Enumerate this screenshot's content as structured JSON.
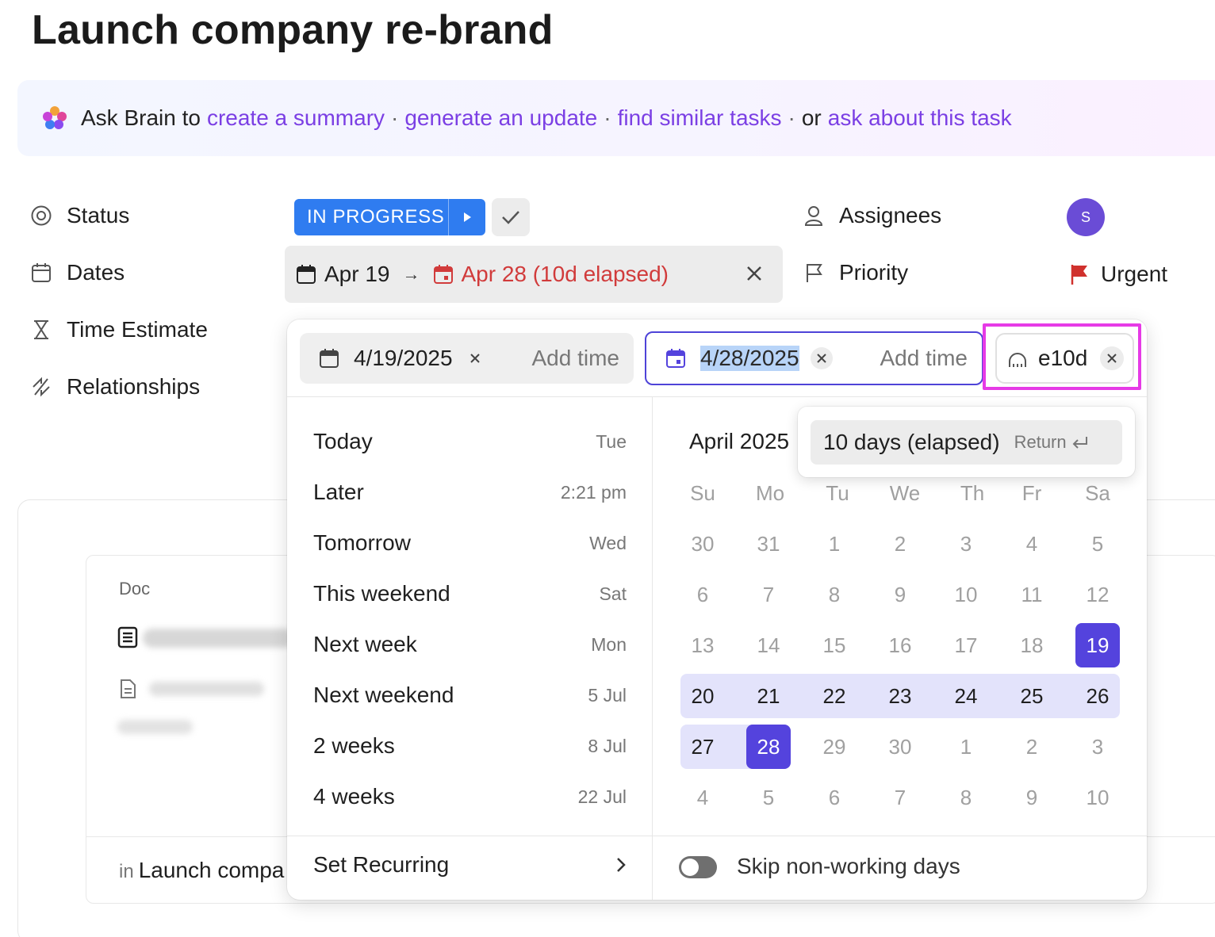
{
  "task": {
    "title": "Launch company re-brand"
  },
  "brain": {
    "prefix": "Ask Brain to",
    "link1": "create a summary",
    "link2": "generate an update",
    "link3": "find similar tasks",
    "or": "or",
    "link4": "ask about this task",
    "sep": "·"
  },
  "properties": {
    "status_label": "Status",
    "status_value": "IN PROGRESS",
    "dates_label": "Dates",
    "time_estimate_label": "Time Estimate",
    "relationships_label": "Relationships",
    "assignees_label": "Assignees",
    "assignee_initial": "S",
    "priority_label": "Priority",
    "priority_value": "Urgent"
  },
  "dates_bar": {
    "start": "Apr 19",
    "arrow": "→",
    "due": "Apr 28 (10d elapsed)"
  },
  "picker": {
    "start_date": "4/19/2025",
    "due_date": "4/28/2025",
    "add_time": "Add time",
    "duration_input": "e10d",
    "suggestion": "10 days (elapsed)",
    "suggestion_hint": "Return",
    "month_title": "April 2025",
    "weekdays": [
      "Su",
      "Mo",
      "Tu",
      "We",
      "Th",
      "Fr",
      "Sa"
    ],
    "weeks": [
      [
        "30",
        "31",
        "1",
        "2",
        "3",
        "4",
        "5"
      ],
      [
        "6",
        "7",
        "8",
        "9",
        "10",
        "11",
        "12"
      ],
      [
        "13",
        "14",
        "15",
        "16",
        "17",
        "18",
        "19"
      ],
      [
        "20",
        "21",
        "22",
        "23",
        "24",
        "25",
        "26"
      ],
      [
        "27",
        "28",
        "29",
        "30",
        "1",
        "2",
        "3"
      ],
      [
        "4",
        "5",
        "6",
        "7",
        "8",
        "9",
        "10"
      ]
    ],
    "quick_options": [
      {
        "label": "Today",
        "hint": "Tue"
      },
      {
        "label": "Later",
        "hint": "2:21 pm"
      },
      {
        "label": "Tomorrow",
        "hint": "Wed"
      },
      {
        "label": "This weekend",
        "hint": "Sat"
      },
      {
        "label": "Next week",
        "hint": "Mon"
      },
      {
        "label": "Next weekend",
        "hint": "5 Jul"
      },
      {
        "label": "2 weeks",
        "hint": "8 Jul"
      },
      {
        "label": "4 weeks",
        "hint": "22 Jul"
      }
    ],
    "set_recurring": "Set Recurring",
    "skip_non_working": "Skip non-working days",
    "skip_enabled": false
  },
  "background": {
    "doc_label": "Doc",
    "in_label": "in",
    "location": "Launch compa"
  },
  "colors": {
    "accent": "#5443dd",
    "status_blue": "#2f7cf0",
    "brain_link": "#7b3fe4",
    "overdue_red": "#d13b3b",
    "urgent_flag": "#d0312d",
    "highlight_magenta": "#e63ae6"
  }
}
